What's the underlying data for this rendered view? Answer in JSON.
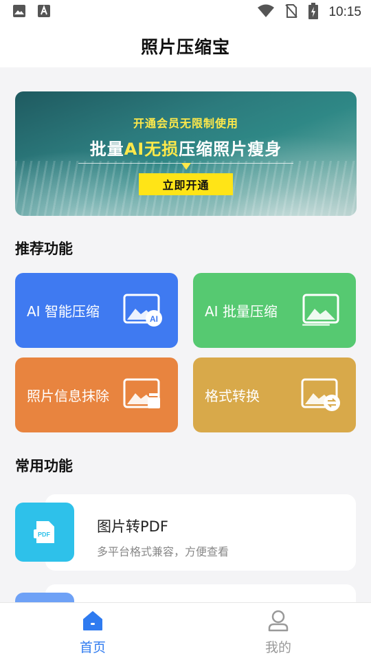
{
  "status_bar": {
    "time": "10:15",
    "icons": [
      "image-notification-icon",
      "font-notification-icon",
      "wifi-icon",
      "no-sim-icon",
      "battery-charging-icon"
    ]
  },
  "app_bar": {
    "title": "照片压缩宝"
  },
  "banner": {
    "subtitle": "开通会员无限制使用",
    "headline_prefix": "批量",
    "headline_highlight1": "AI无损",
    "headline_suffix": "压缩照片瘦身",
    "button_label": "立即开通",
    "colors": {
      "highlight": "#ffe94a",
      "button": "#ffe417"
    }
  },
  "recommended": {
    "title": "推荐功能",
    "cards": [
      {
        "label": "AI 智能压缩",
        "icon": "ai-image-icon",
        "color": "#3f7af1"
      },
      {
        "label": "AI 批量压缩",
        "icon": "image-stack-icon",
        "color": "#56c971"
      },
      {
        "label": "照片信息抹除",
        "icon": "image-erase-icon",
        "color": "#e8843f"
      },
      {
        "label": "格式转换",
        "icon": "image-convert-icon",
        "color": "#d8a94a"
      }
    ]
  },
  "common": {
    "title": "常用功能",
    "items": [
      {
        "title": "图片转PDF",
        "desc": "多平台格式兼容，方便查看",
        "icon": "pdf-file-icon",
        "color": "#2ec1ea"
      }
    ]
  },
  "bottom_nav": {
    "items": [
      {
        "label": "首页",
        "icon": "home-icon",
        "active": true
      },
      {
        "label": "我的",
        "icon": "user-icon",
        "active": false
      }
    ],
    "colors": {
      "active": "#2f7bf0",
      "inactive": "#999999"
    }
  }
}
